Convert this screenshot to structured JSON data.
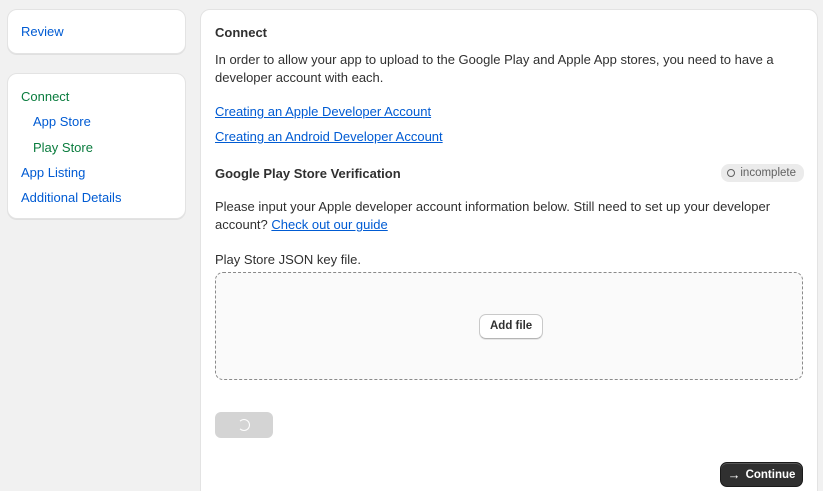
{
  "sidebar": {
    "review_label": "Review",
    "items": [
      {
        "label": "Connect"
      },
      {
        "label": "App Store"
      },
      {
        "label": "Play Store"
      },
      {
        "label": "App Listing"
      },
      {
        "label": "Additional Details"
      }
    ]
  },
  "main": {
    "title": "Connect",
    "intro": "In order to allow your app to upload to the Google Play and Apple App stores, you need to have a developer account with each.",
    "links": [
      {
        "label": "Creating an Apple Developer Account"
      },
      {
        "label": "Creating an Android Developer Account"
      }
    ],
    "verification": {
      "title": "Google Play Store Verification",
      "status_badge": "incomplete",
      "description": "Please input your Apple developer account information below. Still need to set up your developer account?",
      "guide_link": "Check out our guide"
    },
    "file_field": {
      "label": "Play Store JSON key file.",
      "add_file_label": "Add file"
    },
    "continue_label": "Continue"
  },
  "colors": {
    "page_bg": "#f1f1f1",
    "link": "#005bd3",
    "active_nav": "#0a7c3e",
    "primary_button": "#303030",
    "disabled_button": "#d4d4d4"
  },
  "icons": {
    "badge": "circle-outline-icon",
    "loading": "spinner-icon",
    "continue": "arrow-right-icon"
  }
}
